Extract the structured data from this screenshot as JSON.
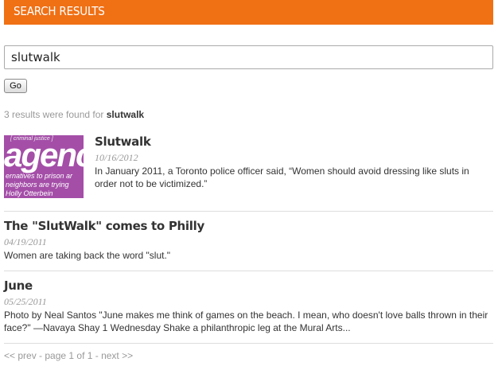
{
  "header": {
    "title": "SEARCH RESULTS"
  },
  "search": {
    "value": "slutwalk",
    "go_label": "Go"
  },
  "summary": {
    "prefix": "3 results were found for",
    "term": "slutwalk"
  },
  "results": [
    {
      "title": "Slutwalk",
      "date": "10/16/2012",
      "excerpt": "In January 2011, a Toronto police officer said, “Women should avoid dressing like sluts in order not to be victimized.”",
      "thumbnail": {
        "top_text": "[ criminal justice ]",
        "big_text": "agenc",
        "line1": "ernatives to prison ar",
        "line2": "neighbors are trying",
        "line3": "Holly Otterbein"
      }
    },
    {
      "title": "The \"SlutWalk\" comes to Philly",
      "date": "04/19/2011",
      "excerpt": "Women are taking back the word \"slut.\""
    },
    {
      "title": "June",
      "date": "05/25/2011",
      "excerpt": "Photo by Neal Santos \"June makes me think of games on the beach. I mean, who doesn't love balls thrown in their face?\" —Navaya Shay 1 Wednesday Shake a philanthropic leg at the Mural Arts..."
    }
  ],
  "pager": {
    "text": "<< prev - page 1 of 1 - next >>"
  },
  "colors": {
    "header_bg": "#f07014",
    "thumb_bg": "#a44ea8"
  }
}
